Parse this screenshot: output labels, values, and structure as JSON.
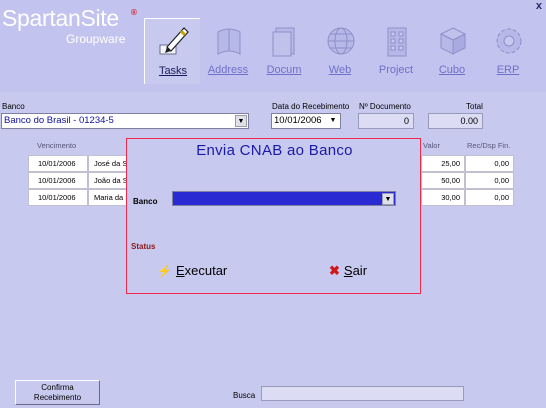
{
  "app": {
    "brand": "SpartanSite",
    "brand_reg": "®",
    "brand_sub": "Groupware",
    "close": "x"
  },
  "toolbar": [
    {
      "label": "Tasks",
      "icon": "pen-nib-icon",
      "active": true
    },
    {
      "label": "Address",
      "icon": "address-book-icon",
      "active": false
    },
    {
      "label": "Docum",
      "icon": "document-icon",
      "active": false
    },
    {
      "label": "Web",
      "icon": "globe-icon",
      "active": false
    },
    {
      "label": "Project",
      "icon": "building-icon",
      "active": false
    },
    {
      "label": "Cubo",
      "icon": "cube-icon",
      "active": false
    },
    {
      "label": "ERP",
      "icon": "gear-icon",
      "active": false
    }
  ],
  "filters": {
    "banco_label": "Banco",
    "banco_value": "Banco do Brasil - 01234-5",
    "data_label": "Data do Recebimento",
    "data_value": "10/01/2006",
    "documento_label": "Nº Documento",
    "documento_value": "0",
    "total_label": "Total",
    "total_value": "0.00"
  },
  "grid": {
    "columns": [
      "Vencimento",
      "Valor",
      "Rec/Dsp Fin."
    ],
    "rows": [
      {
        "vencimento": "10/01/2006",
        "nome": "José da S",
        "valor": "25,00",
        "rec": "0,00"
      },
      {
        "vencimento": "10/01/2006",
        "nome": "João da S",
        "valor": "50,00",
        "rec": "0,00"
      },
      {
        "vencimento": "10/01/2006",
        "nome": "Maria da S",
        "valor": "30,00",
        "rec": "0,00"
      }
    ]
  },
  "dialog": {
    "title": "Envia CNAB ao Banco",
    "banco_label": "Banco",
    "banco_value": "",
    "status_label": "Status",
    "execute_label": "Executar",
    "execute_hotkey": "E",
    "exit_label": "Sair",
    "exit_hotkey": "S"
  },
  "footer": {
    "confirm_line1": "Confirma",
    "confirm_line2": "Recebimento",
    "search_label": "Busca",
    "search_value": ""
  },
  "colors": {
    "background": "#c8c9ef",
    "dialog_border": "#ee2a4a",
    "dialog_title": "#1a1aa8",
    "combo_selected": "#2a2ad2"
  }
}
